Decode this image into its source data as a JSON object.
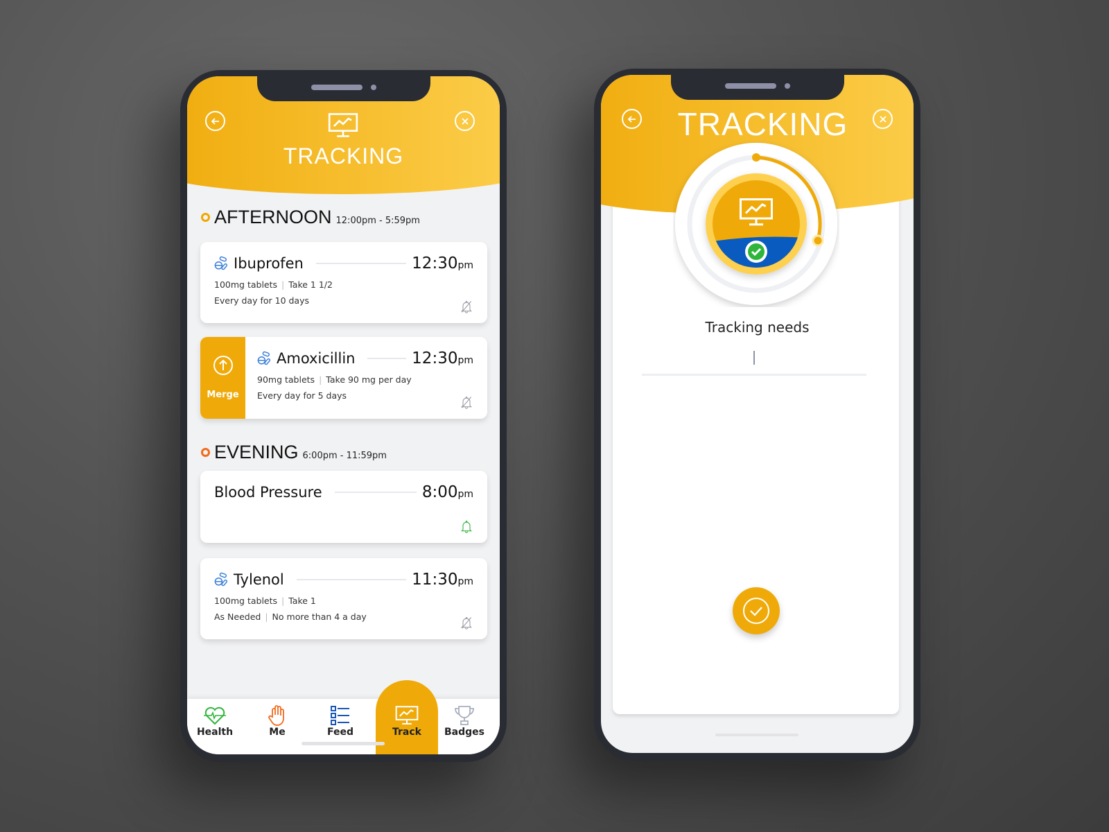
{
  "left_screen": {
    "header": {
      "title": "TRACKING",
      "back_icon": "arrow-left-circle-icon",
      "close_icon": "close-circle-icon",
      "header_icon": "monitor-chart-icon"
    },
    "sections": [
      {
        "name": "AFTERNOON",
        "range": "12:00pm - 5:59pm",
        "dot_color": "#f0a800"
      },
      {
        "name": "EVENING",
        "range": "6:00pm - 11:59pm",
        "dot_color": "#f26a1b"
      }
    ],
    "cards": [
      {
        "name": "Ibuprofen",
        "time": "12:30",
        "ampm": "pm",
        "dose": "100mg tablets",
        "take": "Take 1 1/2",
        "schedule": "Every day for 10 days",
        "icon": "pills-icon",
        "bell": "bell-off-icon"
      },
      {
        "name": "Amoxicillin",
        "time": "12:30",
        "ampm": "pm",
        "dose": "90mg tablets",
        "take": "Take 90 mg per day",
        "schedule": "Every day for 5 days",
        "icon": "pills-icon",
        "bell": "bell-off-icon",
        "action": "Merge"
      },
      {
        "name": "Blood Pressure",
        "time": "8:00",
        "ampm": "pm",
        "bell": "bell-icon"
      },
      {
        "name": "Tylenol",
        "time": "11:30",
        "ampm": "pm",
        "dose": "100mg tablets",
        "take": "Take 1",
        "schedule": "As Needed",
        "limit": "No more than 4 a day",
        "icon": "pills-icon",
        "bell": "bell-off-icon"
      }
    ],
    "nav": [
      {
        "label": "Health",
        "icon": "heart-pulse-icon"
      },
      {
        "label": "Me",
        "icon": "hand-icon"
      },
      {
        "label": "Feed",
        "icon": "list-icon"
      },
      {
        "label": "Track",
        "icon": "monitor-chart-icon",
        "active": true
      },
      {
        "label": "Badges",
        "icon": "trophy-icon"
      }
    ]
  },
  "right_screen": {
    "header": {
      "title": "TRACKING"
    },
    "prompt": "Tracking needs",
    "input_value": "",
    "confirm_icon": "check-circle-icon"
  },
  "colors": {
    "accent": "#efaa0a",
    "accent_light": "#fdd04f",
    "blue": "#0a5bbf",
    "green": "#2fb53a",
    "orange": "#f26a1b"
  }
}
